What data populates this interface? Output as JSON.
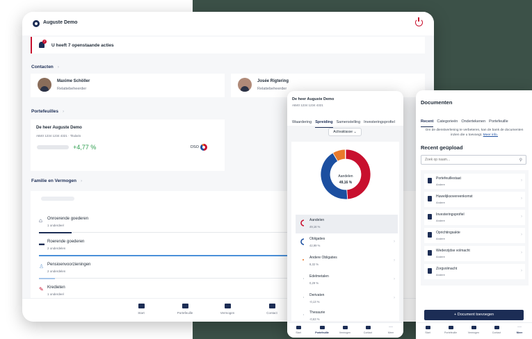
{
  "tablet": {
    "user_name": "Auguste Demo",
    "alert_badge": "7",
    "alert_text": "U heeft 7 openstaande acties",
    "contacts_title": "Contacten",
    "contacts": [
      {
        "name": "Maxime Schöller",
        "role": "Relatiebeheerder"
      },
      {
        "name": "Josée Rigtering",
        "role": "Relatiebeheerder"
      }
    ],
    "portfolios_title": "Portefeuilles",
    "portfolio": {
      "name": "De heer Auguste Demo",
      "account": "AB40 1234 1234 4321 · Titularis",
      "performance": "+4,77 %",
      "tag": "DSO"
    },
    "family_title": "Familie en Vermogen",
    "family_items": [
      {
        "label": "Onroerende goederen",
        "count": "1 onderdeel",
        "color": "#1c2d55",
        "fill": 0.12,
        "icon": "house-icon"
      },
      {
        "label": "Roerende goederen",
        "count": "2 onderdelen",
        "color": "#4a90d9",
        "fill": 1.0,
        "icon": "banknote-icon"
      },
      {
        "label": "Pensioenvoorzieningen",
        "count": "2 onderdelen",
        "color": "#a7c7ea",
        "fill": 0.06,
        "icon": "pension-icon"
      },
      {
        "label": "Kredieten",
        "count": "1 onderdeel",
        "color": "#c8102e",
        "fill": 0.08,
        "icon": "credit-icon"
      }
    ],
    "nav": [
      {
        "label": "Start",
        "active": true
      },
      {
        "label": "Portefeuille",
        "active": false
      },
      {
        "label": "Vermogen",
        "active": false
      },
      {
        "label": "Contact",
        "active": false
      },
      {
        "label": "Meer",
        "active": false
      }
    ]
  },
  "phone1": {
    "title": "De heer Auguste Demo",
    "account": "AB40 1234 1234 4321",
    "tabs": [
      "Waardering",
      "Spreiding",
      "Samenstelling",
      "Investeringsprofiel"
    ],
    "active_tab": "Spreiding",
    "select_label": "Activaklasse",
    "donut_center_label": "Aandelen",
    "donut_center_value": "49,16 %",
    "allocation": [
      {
        "name": "Aandelen",
        "pct": "49,16 %",
        "value": 49.16,
        "color": "#c8102e",
        "selected": true
      },
      {
        "name": "Obligaties",
        "pct": "42,99 %",
        "value": 42.99,
        "color": "#1c4fa0",
        "selected": false
      },
      {
        "name": "Andere Obligaties",
        "pct": "8,32 %",
        "value": 8.32,
        "color": "#e97a2c",
        "selected": false
      },
      {
        "name": "Edelmetalen",
        "pct": "0,29 %",
        "value": 0.29,
        "color": "#9aa3b0",
        "selected": false
      },
      {
        "name": "Derivaten",
        "pct": "-0,13 %",
        "value": -0.13,
        "color": "#9aa3b0",
        "selected": false
      },
      {
        "name": "Thesaurie",
        "pct": "-0,63 %",
        "value": -0.63,
        "color": "#9aa3b0",
        "selected": false
      }
    ],
    "nav": [
      {
        "label": "Start",
        "active": false
      },
      {
        "label": "Portefeuille",
        "active": true
      },
      {
        "label": "Vermogen",
        "active": false
      },
      {
        "label": "Contact",
        "active": false
      },
      {
        "label": "Meer",
        "active": false
      }
    ]
  },
  "phone2": {
    "title": "Documenten",
    "tabs": [
      "Recent",
      "Categorieën",
      "Ondertekenen",
      "Portefeuille"
    ],
    "active_tab": "Recent",
    "info_text": "Om de dienstverlening te verbeteren, kan de bank de documenten inzien die u toevoegt.",
    "info_link": "Meer info.",
    "recent_title": "Recent geüpload",
    "search_placeholder": "Zoek op naam...",
    "documents": [
      {
        "name": "Portefeuillestaat",
        "category": "Andere"
      },
      {
        "name": "Huwelijksovereenkomst",
        "category": "Andere"
      },
      {
        "name": "Investeringsprofiel",
        "category": "Andere"
      },
      {
        "name": "Oprichtingsakte",
        "category": "Andere"
      },
      {
        "name": "Wederzijdse volmacht",
        "category": "Andere"
      },
      {
        "name": "Zorgvolmacht",
        "category": "Andere"
      }
    ],
    "add_button": "+ Document toevoegen",
    "nav": [
      {
        "label": "Start",
        "active": false
      },
      {
        "label": "Portefeuille",
        "active": false
      },
      {
        "label": "Vermogen",
        "active": false
      },
      {
        "label": "Contact",
        "active": false
      },
      {
        "label": "Meer",
        "active": true
      }
    ]
  }
}
